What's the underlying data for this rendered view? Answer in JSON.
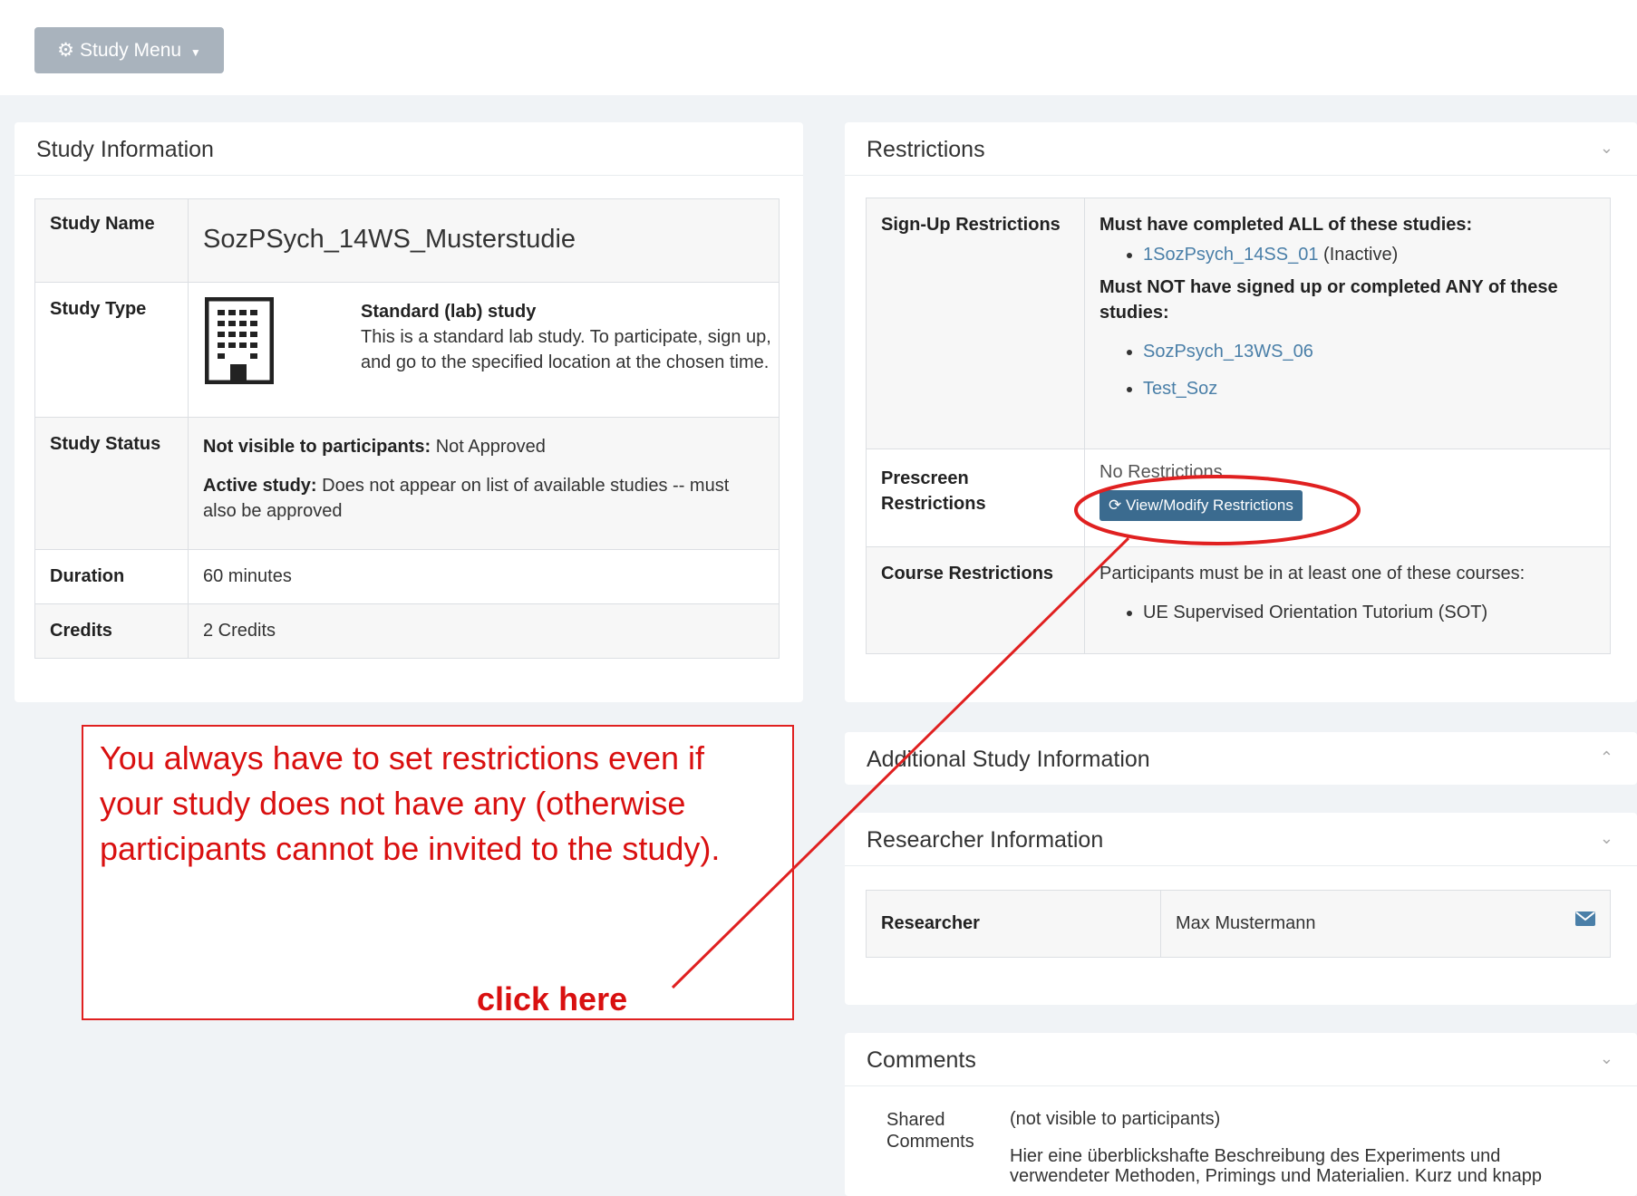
{
  "toolbar": {
    "study_menu_label": "Study Menu",
    "gear_icon": "gear-icon",
    "caret_icon": "caret-down-icon"
  },
  "study_info": {
    "title": "Study Information",
    "name_label": "Study Name",
    "name_value": "SozPSych_14WS_Musterstudie",
    "type_label": "Study Type",
    "type_icon": "building-icon",
    "type_title": "Standard (lab) study",
    "type_desc": "This is a standard lab study. To participate, sign up, and go to the specified location at the chosen time.",
    "status_label": "Study Status",
    "status_line1_bold": "Not visible to participants:",
    "status_line1_rest": " Not Approved",
    "status_line2_bold": "Active study:",
    "status_line2_rest": " Does not appear on list of available studies -- must also be approved",
    "duration_label": "Duration",
    "duration_value": "60 minutes",
    "credits_label": "Credits",
    "credits_value": "2 Credits"
  },
  "restrictions": {
    "title": "Restrictions",
    "signup_label": "Sign-Up Restrictions",
    "must_completed_heading": "Must have completed ALL of these studies:",
    "completed_studies": [
      {
        "name": "1SozPsych_14SS_01",
        "note": "(Inactive)"
      }
    ],
    "must_not_heading": "Must NOT have signed up or completed ANY of these studies:",
    "not_studies": [
      "SozPsych_13WS_06",
      "Test_Soz"
    ],
    "prescreen_label": "Prescreen Restrictions",
    "prescreen_value": "No Restrictions",
    "modify_button": "View/Modify Restrictions",
    "refresh_icon": "refresh-icon",
    "course_label": "Course Restrictions",
    "course_text": "Participants must be in at least one of these courses:",
    "courses": [
      "UE Supervised Orientation Tutorium (SOT)"
    ]
  },
  "additional": {
    "title": "Additional Study Information"
  },
  "researcher": {
    "title": "Researcher Information",
    "label": "Researcher",
    "name": "Max Mustermann",
    "mail_icon": "envelope-icon"
  },
  "comments": {
    "title": "Comments",
    "shared_label": "Shared Comments",
    "visibility_note": "(not visible to participants)",
    "text": "Hier eine überblickshafte Beschreibung des Experiments und verwendeter Methoden, Primings und Materialien. Kurz und knapp"
  },
  "annotation": {
    "text": "You always have to set restrictions even if your study does not have any (otherwise participants cannot be invited to the study).",
    "click_here": "click here",
    "color": "#e02020"
  }
}
